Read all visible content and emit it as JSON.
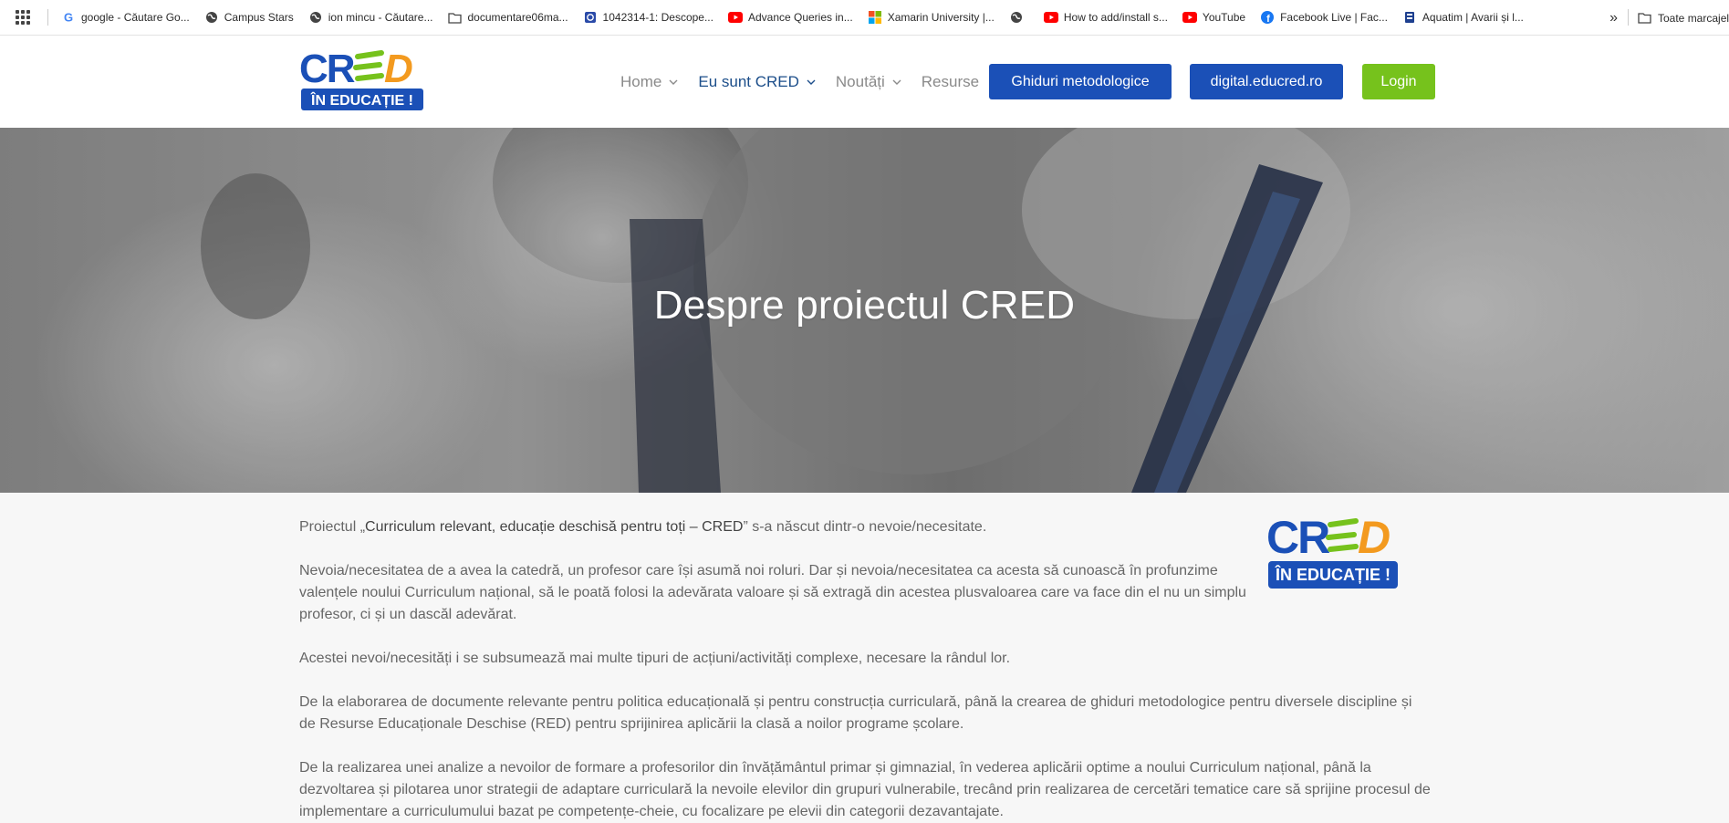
{
  "bookmarks": [
    {
      "icon": "google-icon",
      "label": "google - Căutare Go..."
    },
    {
      "icon": "globe-icon",
      "label": "Campus Stars"
    },
    {
      "icon": "globe-icon",
      "label": "ion mincu - Căutare..."
    },
    {
      "icon": "folder-icon",
      "label": "documentare06ma..."
    },
    {
      "icon": "book-icon",
      "label": "1042314-1: Descope..."
    },
    {
      "icon": "youtube-icon",
      "label": "Advance Queries in..."
    },
    {
      "icon": "microsoft-icon",
      "label": "Xamarin University |..."
    },
    {
      "icon": "globe-icon",
      "label": ""
    },
    {
      "icon": "youtube-icon",
      "label": "How to add/install s..."
    },
    {
      "icon": "youtube-icon",
      "label": "YouTube"
    },
    {
      "icon": "facebook-icon",
      "label": "Facebook Live | Fac..."
    },
    {
      "icon": "aquatim-icon",
      "label": "Aquatim | Avarii și l..."
    }
  ],
  "bookmarks_more": "»",
  "bookmarks_folder": "Toate marcajele",
  "header": {
    "logo_text_top": "CRED",
    "logo_text_bottom": "ÎN EDUCAȚIE !",
    "nav": [
      {
        "label": "Home",
        "dropdown": true,
        "active": false
      },
      {
        "label": "Eu sunt CRED",
        "dropdown": true,
        "active": true
      },
      {
        "label": "Noutăți",
        "dropdown": true,
        "active": false
      },
      {
        "label": "Resurse",
        "dropdown": false,
        "active": false
      }
    ],
    "btn_guides": "Ghiduri metodologice",
    "btn_digital": "digital.educred.ro",
    "btn_login": "Login"
  },
  "hero": {
    "title": "Despre proiectul CRED"
  },
  "content": {
    "p1_pre": "Proiectul „",
    "p1_bold": "Curriculum relevant, educație deschisă pentru toți – CRED",
    "p1_post": "” s-a născut dintr-o nevoie/necesitate.",
    "p2": "Nevoia/necesitatea de a avea la catedră, un profesor care își asumă noi roluri. Dar și nevoia/necesitatea ca acesta să cunoască în profunzime valențele noului Curriculum național, să le poată folosi la adevărata valoare și să extragă din acestea plusvaloarea care va face din el nu un simplu profesor, ci și un dascăl adevărat.",
    "p3": "Acestei nevoi/necesități i se subsumează mai multe tipuri de acțiuni/activități complexe, necesare la rândul lor.",
    "p4": "De la elaborarea de documente relevante pentru politica educațională și pentru construcția curriculară, până la crearea de ghiduri metodologice pentru diversele discipline și de Resurse Educaționale Deschise (RED) pentru sprijinirea aplicării la clasă a noilor programe școlare.",
    "p5": "De la realizarea unei analize a nevoilor de formare a profesorilor din învățământul primar și gimnazial, în vederea aplicării optime a noului Curriculum național, până la dezvoltarea și pilotarea unor strategii de adaptare curriculară la nevoile elevilor din grupuri vulnerabile, trecând prin realizarea de cercetări tematice care să sprijine procesul de implementare a curriculumului bazat pe competențe-cheie, cu focalizare pe elevii din categorii dezavantajate."
  },
  "colors": {
    "brand_blue": "#1b50b7",
    "brand_green": "#76c21c",
    "logo_orange": "#f39a1f",
    "nav_active": "#1c4e8a"
  }
}
